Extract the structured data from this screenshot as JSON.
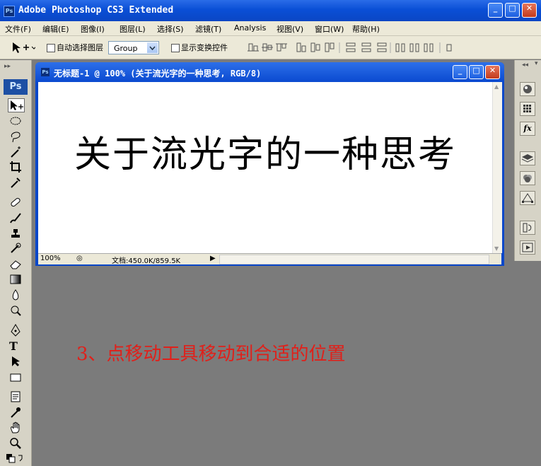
{
  "app": {
    "title": "Adobe Photoshop CS3 Extended",
    "logo": "Ps"
  },
  "menu": [
    "文件(F)",
    "编辑(E)",
    "图像(I)",
    "图层(L)",
    "选择(S)",
    "滤镜(T)",
    "Analysis",
    "视图(V)",
    "窗口(W)",
    "帮助(H)"
  ],
  "options": {
    "auto_select_label": "自动选择图层",
    "auto_select_value": "Group",
    "show_transform_label": "显示变换控件"
  },
  "document": {
    "title": "无标题-1 @ 100% (关于流光字的一种思考, RGB/8)",
    "canvas_text": "关于流光字的一种思考",
    "zoom": "100%",
    "doc_size": "文档:450.0K/859.5K"
  },
  "annotation": "3、点移动工具移动到合适的位置",
  "colors": {
    "title_blue": "#0a4fd6",
    "annotation_red": "#e0201a",
    "workspace": "#7b7b7b"
  }
}
